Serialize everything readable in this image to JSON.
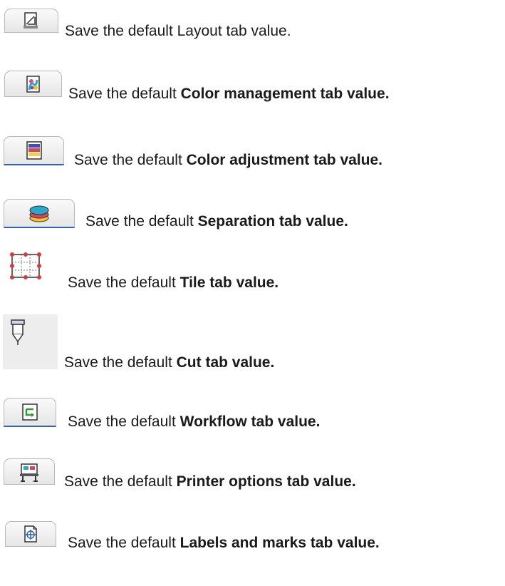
{
  "items": [
    {
      "prefix": "Save the default ",
      "plain": "Layout tab value.",
      "bold": "",
      "icon": "layout-tab-icon"
    },
    {
      "prefix": "Save the default ",
      "plain": "",
      "bold": "Color management tab value.",
      "icon": "color-management-tab-icon"
    },
    {
      "prefix": "Save the default ",
      "plain": "",
      "bold": "Color adjustment tab value.",
      "icon": "color-adjustment-tab-icon"
    },
    {
      "prefix": "Save the default ",
      "plain": "",
      "bold": "Separation tab value.",
      "icon": "separation-tab-icon"
    },
    {
      "prefix": "Save the default ",
      "plain": "",
      "bold": "Tile tab value.",
      "icon": "tile-tab-icon"
    },
    {
      "prefix": "Save the default ",
      "plain": "",
      "bold": "Cut tab value.",
      "icon": "cut-tab-icon"
    },
    {
      "prefix": "Save the default ",
      "plain": "",
      "bold": "Workflow tab value.",
      "icon": "workflow-tab-icon"
    },
    {
      "prefix": "Save the default ",
      "plain": "",
      "bold": "Printer options tab value.",
      "icon": "printer-options-tab-icon"
    },
    {
      "prefix": "Save the default ",
      "plain": "",
      "bold": "Labels and marks tab value.",
      "icon": "labels-and-marks-tab-icon"
    }
  ]
}
